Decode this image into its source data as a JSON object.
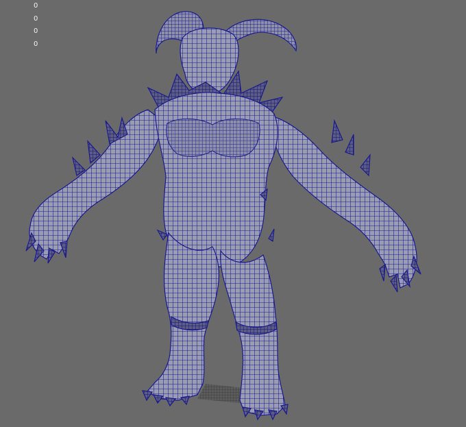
{
  "viewport": {
    "background_color": "#6a6a6a",
    "wireframe_color": "#1a1a8c",
    "surface_color": "#9a9cb4",
    "hud_values": [
      "0",
      "0",
      "0",
      "0"
    ],
    "model": "horned-demon-wireframe-mesh"
  }
}
